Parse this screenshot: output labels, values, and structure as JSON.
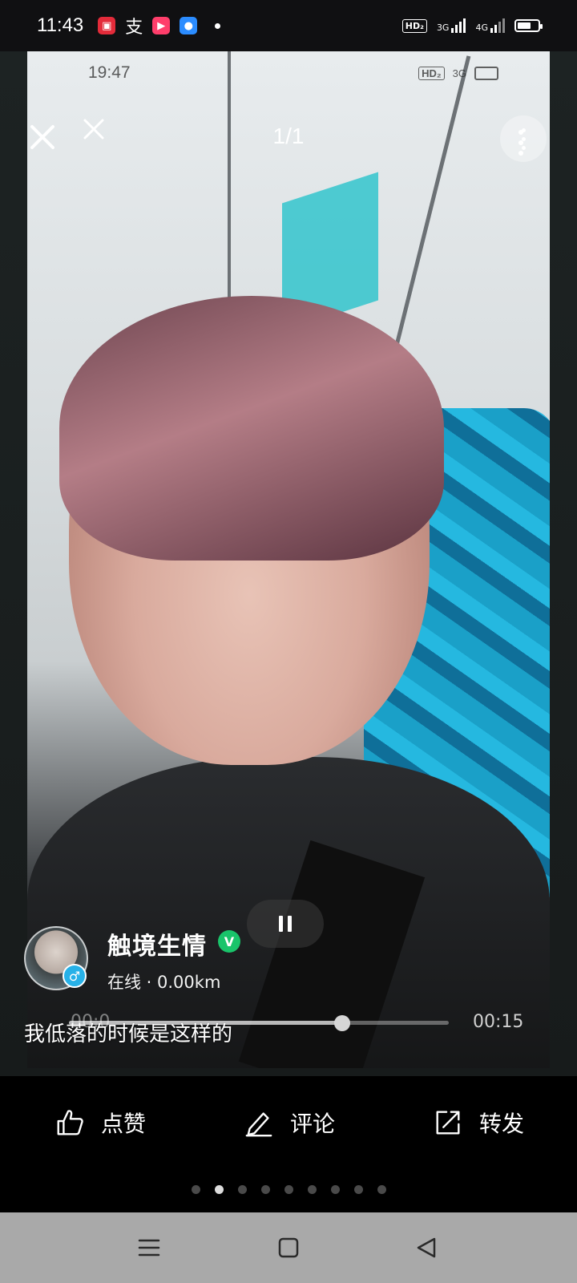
{
  "status_bar": {
    "time": "11:43",
    "network_badge": "HD₂",
    "signal_1": "3G",
    "signal_2": "4G"
  },
  "viewer": {
    "counter": "1/1",
    "inner_time": "19:47",
    "inner_badge": "HD₂",
    "inner_signal": "3G"
  },
  "profile": {
    "username": "触境生情",
    "verified_mark": "V",
    "gender_icon": "♂",
    "status": "在线 · 0.00km"
  },
  "post": {
    "caption": "我低落的时候是这样的"
  },
  "player": {
    "current_time": "00:0",
    "duration": "00:15",
    "progress": 0.72
  },
  "actions": {
    "like_label": "点赞",
    "comment_label": "评论",
    "share_label": "转发"
  },
  "pager": {
    "count": 9,
    "active_index": 1
  },
  "colors": {
    "verified": "#19c46a",
    "gender_badge": "#27b1e8",
    "navbar": "#a9a9a9",
    "seat_blue": "#1aa0c8"
  },
  "icons": {
    "close": "close-icon",
    "more": "more-vertical-icon",
    "pause": "pause-icon",
    "like": "thumb-up-icon",
    "comment": "pencil-icon",
    "share": "share-arrow-icon",
    "nav_menu": "menu-icon",
    "nav_home": "square-home-icon",
    "nav_back": "triangle-back-icon"
  }
}
